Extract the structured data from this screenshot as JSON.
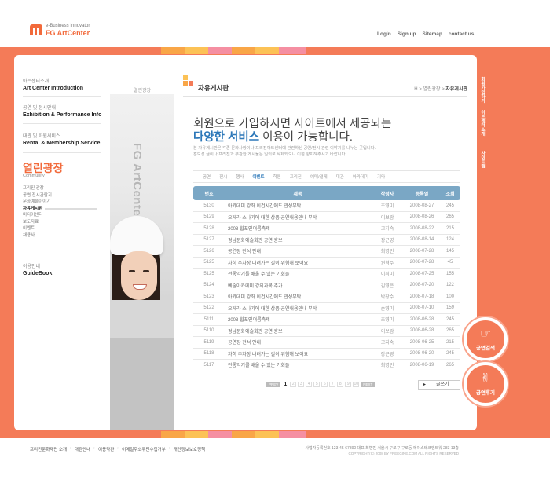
{
  "header": {
    "tagline": "e-Business Innovator",
    "brand": "FG ArtCenter",
    "links": [
      "Login",
      "Sign up",
      "Sitemap",
      "contact us"
    ]
  },
  "colors": {
    "accent": "#f47b58",
    "brand": "#f26a3b",
    "table_header": "#7aa7c5",
    "highlight": "#2d78b9"
  },
  "leftnav": {
    "groups": [
      {
        "kr": "아트센터소개",
        "en": "Art Center Introduction"
      },
      {
        "kr": "공연 및 전시안내",
        "en": "Exhibition & Performance Info"
      },
      {
        "kr": "대관 및 회원서비스",
        "en": "Rental & Membership Service"
      }
    ],
    "active_title": "열린광장",
    "active_sub": "Community",
    "sub_items": [
      "프리진 광장",
      "공연.전시관람기",
      "문화예술이야기",
      "자유게시판",
      "미디어센터",
      "보도자료",
      "이벤트",
      "채용사"
    ],
    "guide_kr": "이용안내",
    "guide_en": "GuideBook"
  },
  "photo": {
    "tab_label": "열린광장",
    "vertical_text": "FG ArtCenter Community"
  },
  "content": {
    "board_title": "자유게시판",
    "breadcrumb": [
      "H",
      "열린광장",
      "자유게시판"
    ],
    "headline_1": "회원으로 가입하시면 사이트에서 제공되는",
    "headline_2_highlight": "다양한 서비스",
    "headline_2_rest": " 이용이 가능합니다.",
    "desc_1": "본 자유게시판은 각종 문화사항이나 프리진아트센터에 관련하신 공연/전시 관련 이야기를 나누는 곳입니다.",
    "desc_2": "홍보성 글이나 프리진과 무관한 게시물은 임의로 삭제되오니 이점 양지해주시기 바랍니다.",
    "categories": [
      "공연",
      "전시",
      "행사",
      "이벤트",
      "학원",
      "프리진",
      "예매/결제",
      "대관",
      "아카데미",
      "기타"
    ],
    "active_category": "이벤트",
    "table": {
      "headers": [
        "번호",
        "제목",
        "작성자",
        "등록일",
        "조회"
      ],
      "rows": [
        [
          "5130",
          "아카데미 강좌 이건시간에도 관성부탁.",
          "조영미",
          "2008-08-27",
          "245"
        ],
        [
          "5129",
          "오페라 소나기에 대한 상품 공연내용안내 부탁",
          "이보람",
          "2008-08-26",
          "265"
        ],
        [
          "5128",
          "2008 힙포인여름축제",
          "고지숙",
          "2008-08-22",
          "215"
        ],
        [
          "5127",
          "경남문화예술회관 공연 홍보",
          "장근영",
          "2008-08-14",
          "124"
        ],
        [
          "5126",
          "공연장 전석 안내",
          "최병민",
          "2008-07-28",
          "145"
        ],
        [
          "5125",
          "차히 주차장 내려가는 길이 위험해 보여요",
          "권혁주",
          "2008-07-28",
          "45"
        ],
        [
          "5125",
          "전통악기를 배울 수 있는 기회들",
          "이쥐미",
          "2008-07-25",
          "155"
        ],
        [
          "5124",
          "예술아카데미 강의과목 추가",
          "김영은",
          "2008-07-20",
          "122"
        ],
        [
          "5123",
          "아카데미 강좌 이건시간에도 관성부탁.",
          "박장수",
          "2008-07-18",
          "100"
        ],
        [
          "5122",
          "오페라 소나기에 대한 상품 공연내용안내 부탁",
          "손영미",
          "2008-07-10",
          "159"
        ],
        [
          "5111",
          "2008 힙포인여름축제",
          "조영미",
          "2008-06-28",
          "245"
        ],
        [
          "5110",
          "경남문화예술회관 공연 홍보",
          "이보람",
          "2008-06-28",
          "265"
        ],
        [
          "5119",
          "공연장 전석 안내",
          "고지숙",
          "2008-06-25",
          "215"
        ],
        [
          "5118",
          "차히 주차장 내려가는 길이 위험해 보여요",
          "장근영",
          "2008-06-20",
          "245"
        ],
        [
          "5117",
          "전통악기를 배울 수 있는 기회들",
          "최병민",
          "2008-06-19",
          "265"
        ]
      ]
    },
    "pager": {
      "prev": "PREV",
      "next": "NEXT",
      "pages": [
        "1",
        "2",
        "3",
        "4",
        "5",
        "6",
        "7",
        "8",
        "9",
        "10"
      ],
      "current": "1"
    },
    "write_button": "글쓰기"
  },
  "right_links": [
    "회원가입하기",
    "아트센터소개",
    "사이트맵"
  ],
  "round_buttons": [
    {
      "label": "공연검색",
      "icon": "hand-point-icon"
    },
    {
      "label": "공연후기",
      "icon": "hand-victory-icon"
    }
  ],
  "footer": {
    "links": [
      "프리진문화재단 소개",
      "대관안내",
      "이용약관",
      "이메일주소무단수집거부",
      "개인정보보호정책"
    ],
    "address": "사업자등록번호 123-45-67890 대표 최병민 서울시 구로구 구로동 에이스테크앤트워 283 13층",
    "copyright": "COPYRIGHT(C) 2008 BY FREEGINE.COM ALL RIGHTS RESERVED"
  }
}
